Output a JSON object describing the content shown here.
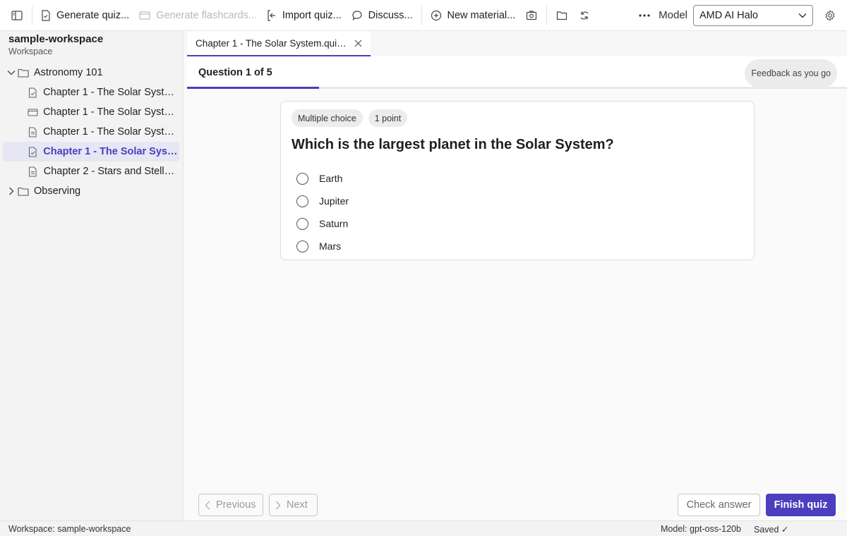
{
  "toolbar": {
    "generate_quiz": "Generate quiz...",
    "generate_flashcards": "Generate flashcards...",
    "import_quiz": "Import quiz...",
    "discuss": "Discuss...",
    "new_material": "New material...",
    "model_label": "Model",
    "model_value": "AMD AI Halo"
  },
  "sidebar": {
    "workspace_name": "sample-workspace",
    "workspace_label": "Workspace",
    "tree": [
      {
        "label": "Astronomy 101",
        "type": "folder",
        "expanded": true
      },
      {
        "label": "Chapter 1 - The Solar System...",
        "type": "quiz-file"
      },
      {
        "label": "Chapter 1 - The Solar System...",
        "type": "flashcards-file"
      },
      {
        "label": "Chapter 1 - The Solar System...",
        "type": "document-file"
      },
      {
        "label": "Chapter 1 - The Solar Syste...",
        "type": "quiz-file",
        "selected": true
      },
      {
        "label": "Chapter 2 - Stars and Stellar...",
        "type": "document-file"
      },
      {
        "label": "Observing",
        "type": "folder",
        "expanded": false
      }
    ]
  },
  "tab": {
    "label": "Chapter 1 - The Solar System.quiz.js..."
  },
  "quiz": {
    "progress_label": "Question 1 of 5",
    "progress_fraction": 0.2,
    "feedback_mode": "Feedback as you go",
    "question": {
      "type": "Multiple choice",
      "points": "1 point",
      "text": "Which is the largest planet in the Solar System?",
      "options": [
        "Earth",
        "Jupiter",
        "Saturn",
        "Mars"
      ]
    }
  },
  "footer": {
    "previous": "Previous",
    "next": "Next",
    "check": "Check answer",
    "finish": "Finish quiz"
  },
  "status": {
    "workspace": "Workspace: sample-workspace",
    "model": "Model: gpt-oss-120b",
    "saved": "Saved ✓"
  },
  "colors": {
    "accent": "#4a3fbf"
  }
}
